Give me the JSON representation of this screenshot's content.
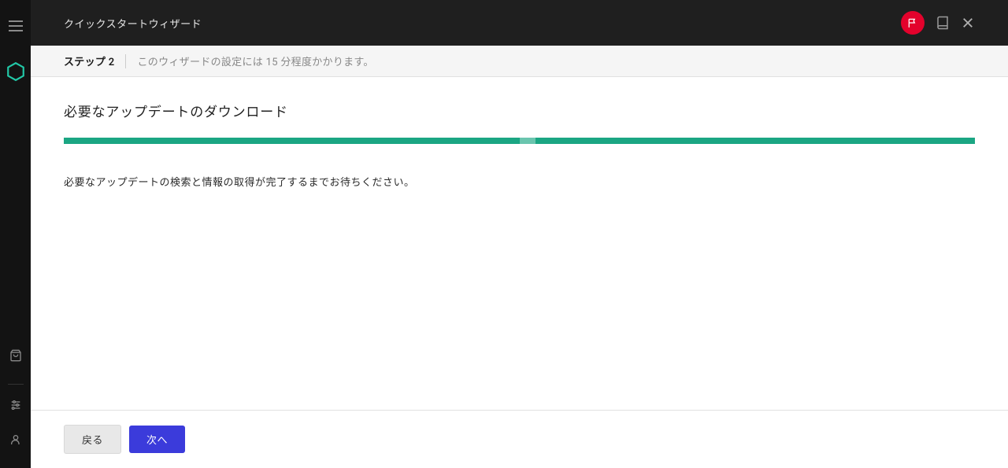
{
  "header": {
    "title": "クイックスタートウィザード"
  },
  "step": {
    "label": "ステップ 2",
    "note": "このウィザードの設定には 15 分程度かかります。"
  },
  "content": {
    "heading": "必要なアップデートのダウンロード",
    "description": "必要なアップデートの検索と情報の取得が完了するまでお待ちください。"
  },
  "footer": {
    "back_label": "戻る",
    "next_label": "次へ"
  }
}
